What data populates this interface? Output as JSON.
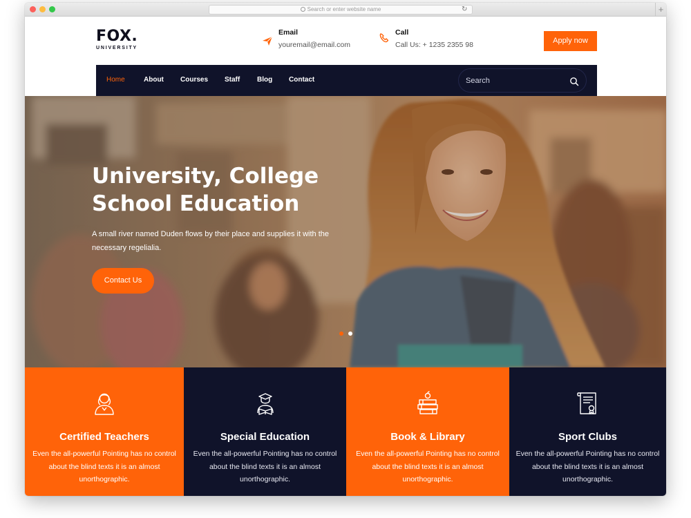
{
  "browser": {
    "url_placeholder": "Search or enter website name",
    "reload_glyph": "↻",
    "new_tab_glyph": "+"
  },
  "header": {
    "logo_main": "FOX.",
    "logo_sub": "UNIVERSITY",
    "email": {
      "title": "Email",
      "value": "youremail@email.com",
      "icon": "paper-plane-icon"
    },
    "call": {
      "title": "Call",
      "value": "Call Us: + 1235 2355 98",
      "icon": "phone-icon"
    },
    "apply_label": "Apply now"
  },
  "nav": {
    "items": [
      "Home",
      "About",
      "Courses",
      "Staff",
      "Blog",
      "Contact"
    ],
    "active_index": 0,
    "search_placeholder": "Search"
  },
  "hero": {
    "title_line1": "University, College",
    "title_line2": "School Education",
    "text": "A small river named Duden flows by their place and supplies it with the necessary regelialia.",
    "button_label": "Contact Us"
  },
  "features": [
    {
      "title": "Certified Teachers",
      "text": "Even the all-powerful Pointing has no control about the blind texts it is an almost unorthographic.",
      "icon": "teacher-icon",
      "theme": "orange"
    },
    {
      "title": "Special Education",
      "text": "Even the all-powerful Pointing has no control about the blind texts it is an almost unorthographic.",
      "icon": "student-reading-icon",
      "theme": "navy"
    },
    {
      "title": "Book & Library",
      "text": "Even the all-powerful Pointing has no control about the blind texts it is an almost unorthographic.",
      "icon": "books-icon",
      "theme": "orange"
    },
    {
      "title": "Sport Clubs",
      "text": "Even the all-powerful Pointing has no control about the blind texts it is an almost unorthographic.",
      "icon": "certificate-icon",
      "theme": "navy"
    }
  ],
  "colors": {
    "accent": "#ff6309",
    "navy": "#10132a"
  }
}
